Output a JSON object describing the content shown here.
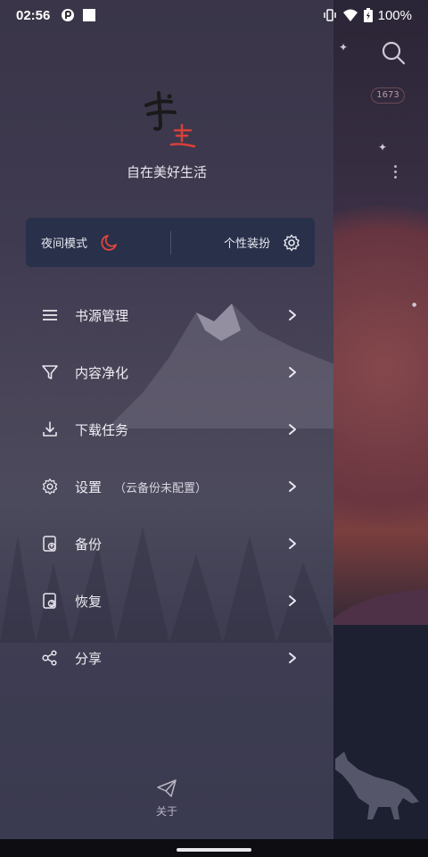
{
  "status_bar": {
    "time": "02:56",
    "battery": "100%"
  },
  "background": {
    "badge": "1673"
  },
  "drawer": {
    "slogan": "自在美好生活",
    "night_mode": "夜间模式",
    "skin": "个性装扮",
    "menu": [
      {
        "label": "书源管理",
        "sub": "",
        "icon": "list-icon"
      },
      {
        "label": "内容净化",
        "sub": "",
        "icon": "filter-icon"
      },
      {
        "label": "下载任务",
        "sub": "",
        "icon": "download-icon"
      },
      {
        "label": "设置",
        "sub": "（云备份未配置）",
        "icon": "gear-icon"
      },
      {
        "label": "备份",
        "sub": "",
        "icon": "backup-icon"
      },
      {
        "label": "恢复",
        "sub": "",
        "icon": "restore-icon"
      },
      {
        "label": "分享",
        "sub": "",
        "icon": "share-icon"
      }
    ],
    "about": "关于"
  },
  "colors": {
    "accent": "#e0463c",
    "card": "#28304a"
  }
}
